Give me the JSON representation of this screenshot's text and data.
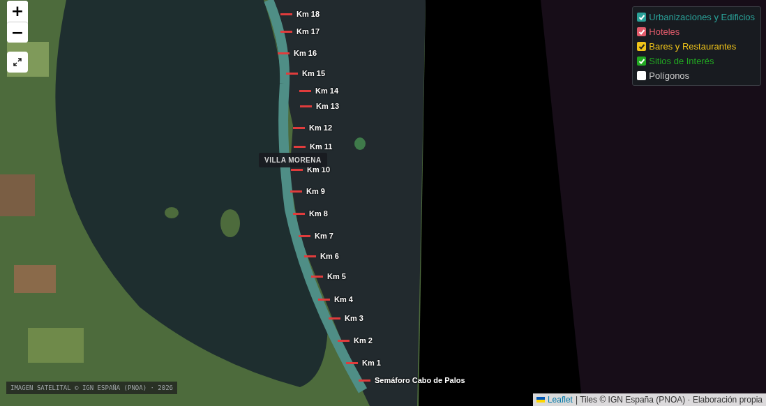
{
  "map_controls": {
    "zoom_in": "+",
    "zoom_out": "−"
  },
  "layers": [
    {
      "label": "Urbanizaciones y Edificios",
      "checked": true,
      "color": "#2aa198"
    },
    {
      "label": "Hoteles",
      "checked": true,
      "color": "#e05a6a"
    },
    {
      "label": "Bares y Restaurantes",
      "checked": true,
      "color": "#f0c419"
    },
    {
      "label": "Sitios de Interés",
      "checked": true,
      "color": "#22a822"
    },
    {
      "label": "Polígonos",
      "checked": false,
      "color": "#c8c8c8"
    }
  ],
  "markers": [
    {
      "label": "Km 18"
    },
    {
      "label": "Km 17"
    },
    {
      "label": "Km 16"
    },
    {
      "label": "Km 15"
    },
    {
      "label": "Km 14"
    },
    {
      "label": "Km 13"
    },
    {
      "label": "Km 12"
    },
    {
      "label": "Km 11"
    },
    {
      "label": "Km 10"
    },
    {
      "label": "Km 9"
    },
    {
      "label": "Km 8"
    },
    {
      "label": "Km 7"
    },
    {
      "label": "Km 6"
    },
    {
      "label": "Km 5"
    },
    {
      "label": "Km 4"
    },
    {
      "label": "Km 3"
    },
    {
      "label": "Km 2"
    },
    {
      "label": "Km 1"
    },
    {
      "label": "Semáforo Cabo de Palos"
    }
  ],
  "tooltip": "VILLA MORENA",
  "imagery_credit": "IMAGEN SATELITAL © IGN ESPAÑA (PNOA) · 2026",
  "attribution": {
    "link": "Leaflet",
    "text": "| Tiles © IGN España (PNOA) · Elaboración propia"
  }
}
